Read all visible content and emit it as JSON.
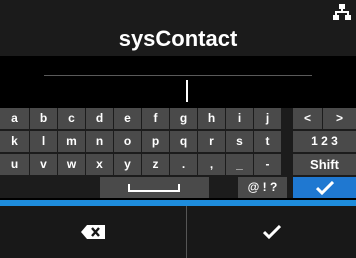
{
  "screen": {
    "title": "sysContact",
    "status_icon": "network-icon"
  },
  "input": {
    "value": ""
  },
  "keyboard": {
    "row1": [
      "a",
      "b",
      "c",
      "d",
      "e",
      "f",
      "g",
      "h",
      "i",
      "j",
      "<",
      ">"
    ],
    "row2": [
      "k",
      "l",
      "m",
      "n",
      "o",
      "p",
      "q",
      "r",
      "s",
      "t",
      "1 2 3"
    ],
    "row3": [
      "u",
      "v",
      "w",
      "x",
      "y",
      "z",
      ".",
      ",",
      "_",
      "-",
      "Shift"
    ],
    "row4": {
      "space_icon": "space-bar-icon",
      "symbols_label": "@ ! ?",
      "enter_icon": "checkmark-icon"
    }
  },
  "bottom": {
    "backspace_icon": "backspace-icon",
    "confirm_icon": "checkmark-icon"
  },
  "colors": {
    "accent": "#1e8cdc",
    "key_bg": "#4a4a4a",
    "keyboard_bg": "#1c1c1c",
    "title_bg": "#1b1b1b"
  }
}
